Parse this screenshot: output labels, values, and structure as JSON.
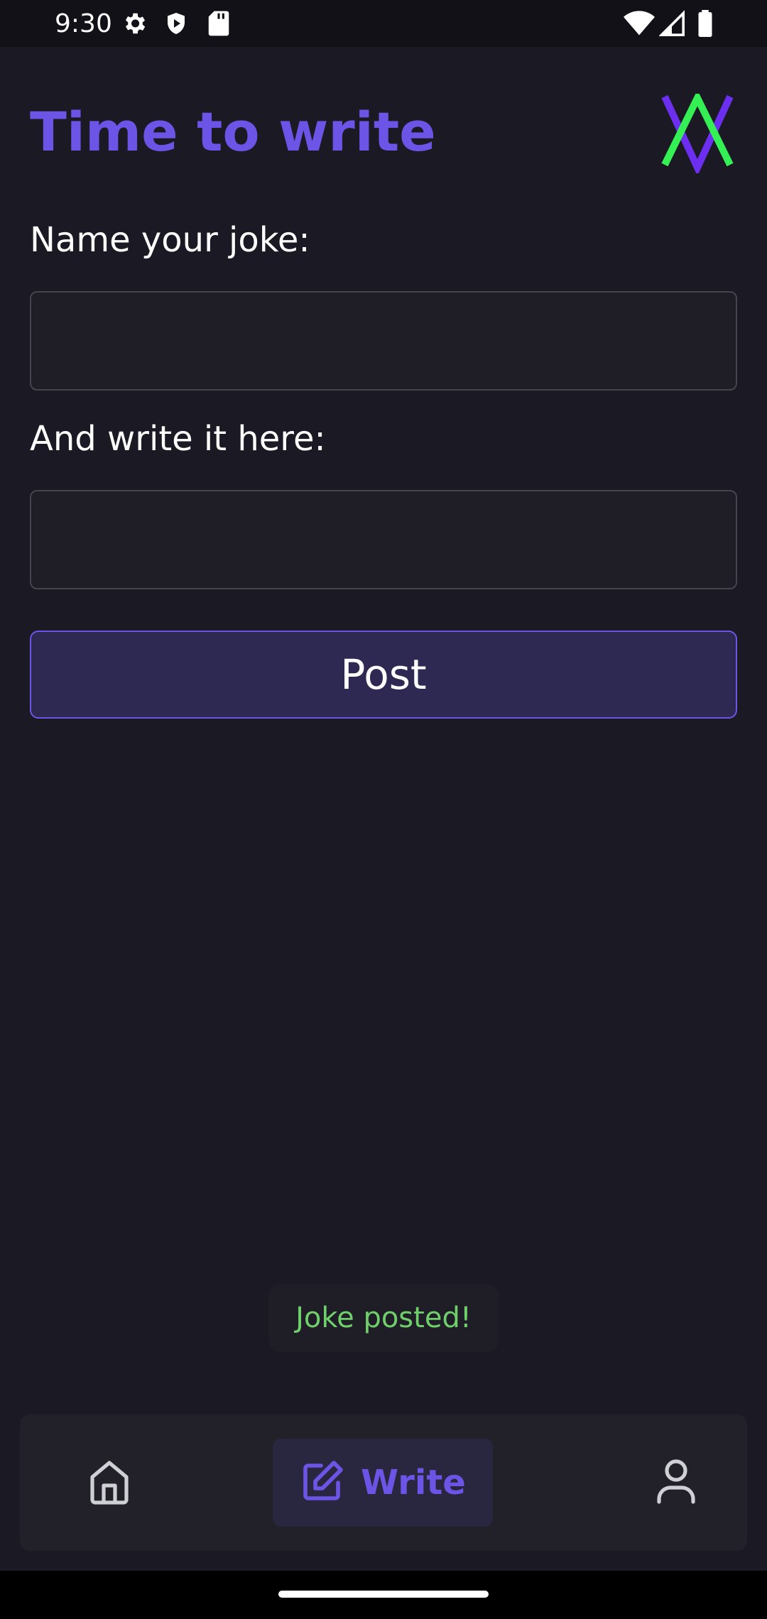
{
  "status_bar": {
    "time": "9:30",
    "icons_left": [
      "settings-icon",
      "shield-play-icon",
      "sd-card-icon"
    ],
    "icons_right": [
      "wifi-icon",
      "signal-icon",
      "battery-icon"
    ]
  },
  "header": {
    "title": "Time to write",
    "logo_icon": "app-logo-icon",
    "title_color": "#6c55e6"
  },
  "form": {
    "name_label": "Name your joke:",
    "name_value": "",
    "body_label": "And write it here:",
    "body_value": "",
    "post_label": "Post"
  },
  "toast": {
    "text": "Joke posted!",
    "color": "#6fcf6b"
  },
  "bottom_nav": {
    "items": [
      {
        "icon": "home-icon",
        "label": "",
        "active": false
      },
      {
        "icon": "pencil-square-icon",
        "label": "Write",
        "active": true
      },
      {
        "icon": "user-icon",
        "label": "",
        "active": false
      }
    ],
    "accent_color": "#6c55e6"
  }
}
